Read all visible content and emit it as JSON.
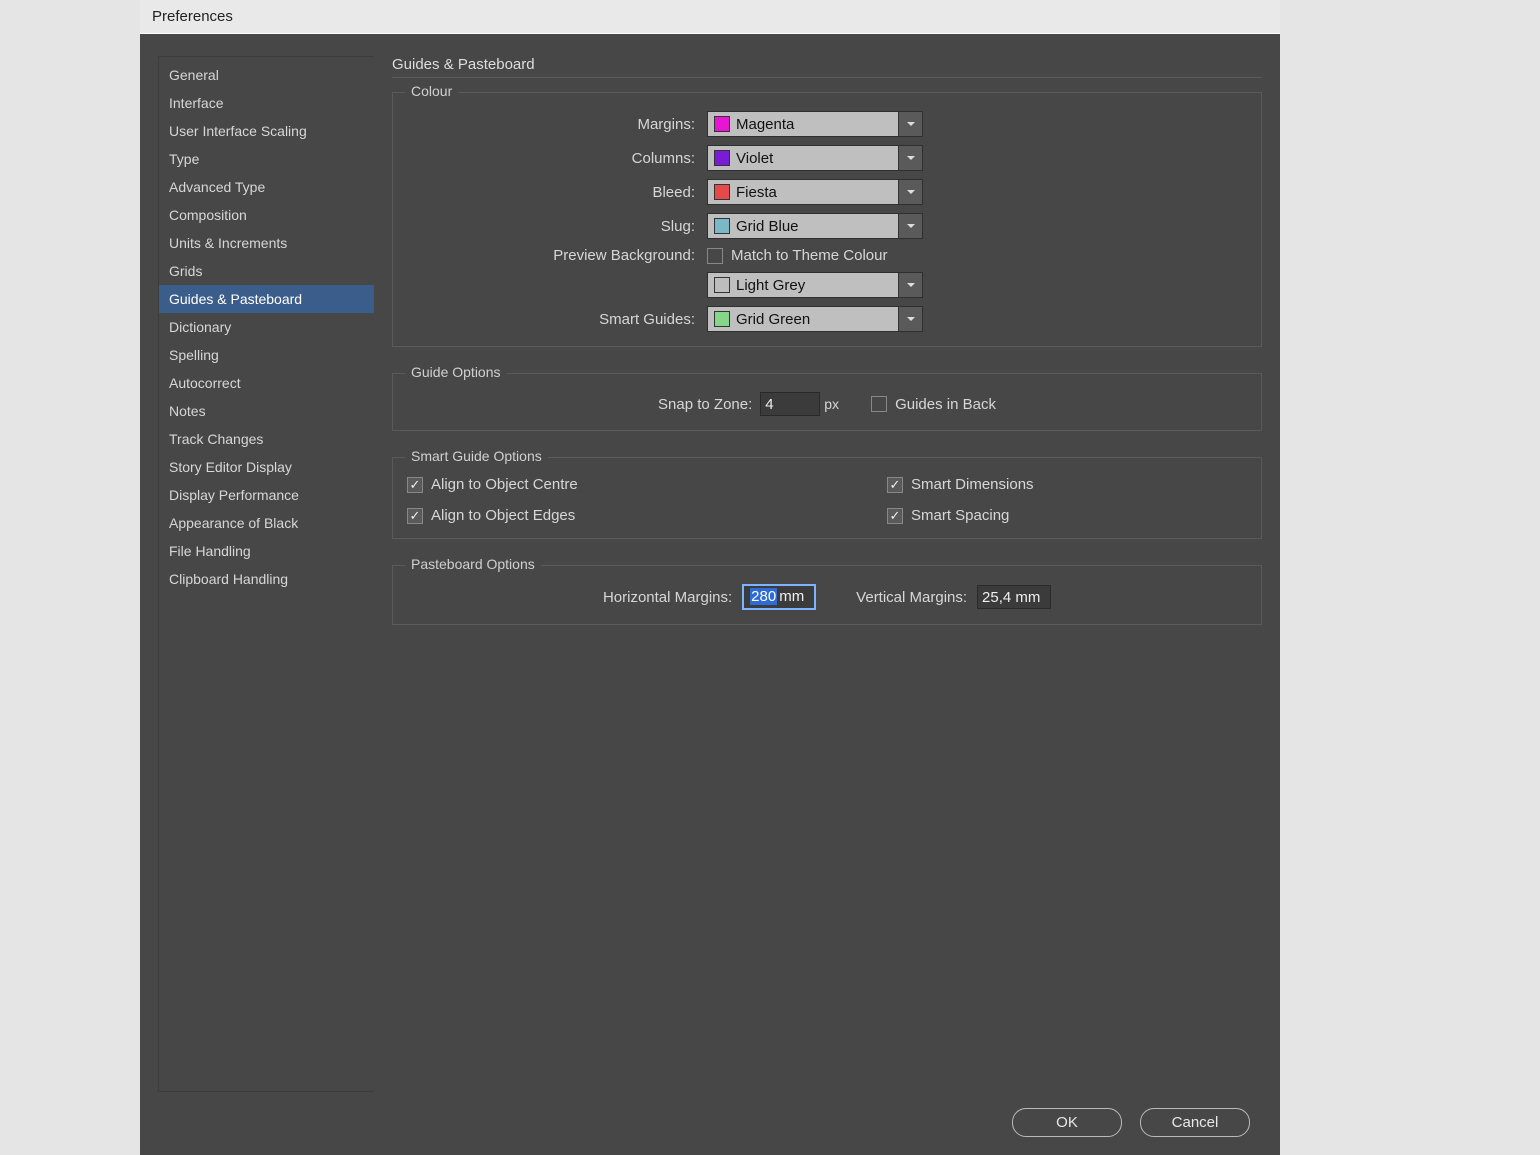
{
  "window": {
    "title": "Preferences"
  },
  "sidebar": {
    "items": [
      "General",
      "Interface",
      "User Interface Scaling",
      "Type",
      "Advanced Type",
      "Composition",
      "Units & Increments",
      "Grids",
      "Guides & Pasteboard",
      "Dictionary",
      "Spelling",
      "Autocorrect",
      "Notes",
      "Track Changes",
      "Story Editor Display",
      "Display Performance",
      "Appearance of Black",
      "File Handling",
      "Clipboard Handling"
    ],
    "selected_index": 8
  },
  "page": {
    "title": "Guides & Pasteboard",
    "colour": {
      "legend": "Colour",
      "rows": {
        "margins": {
          "label": "Margins:",
          "value": "Magenta",
          "swatch": "#e815d3"
        },
        "columns": {
          "label": "Columns:",
          "value": "Violet",
          "swatch": "#7a1cd6"
        },
        "bleed": {
          "label": "Bleed:",
          "value": "Fiesta",
          "swatch": "#e44a4a"
        },
        "slug": {
          "label": "Slug:",
          "value": "Grid Blue",
          "swatch": "#7ab7c7"
        },
        "preview_bg": {
          "label": "Preview Background:",
          "checkbox_label": "Match to Theme Colour",
          "checked": false,
          "value": "Light Grey",
          "swatch": "#bdbdbd"
        },
        "smart_guides": {
          "label": "Smart Guides:",
          "value": "Grid Green",
          "swatch": "#86d68a"
        }
      }
    },
    "guide_options": {
      "legend": "Guide Options",
      "snap_label": "Snap to Zone:",
      "snap_value": "4",
      "snap_unit": "px",
      "guides_in_back": {
        "label": "Guides in Back",
        "checked": false
      }
    },
    "smart_guide_options": {
      "legend": "Smart Guide Options",
      "align_centre": {
        "label": "Align to Object Centre",
        "checked": true
      },
      "align_edges": {
        "label": "Align to Object Edges",
        "checked": true
      },
      "smart_dimensions": {
        "label": "Smart Dimensions",
        "checked": true
      },
      "smart_spacing": {
        "label": "Smart Spacing",
        "checked": true
      }
    },
    "pasteboard_options": {
      "legend": "Pasteboard Options",
      "horiz_label": "Horizontal Margins:",
      "horiz_value": "280",
      "horiz_unit": "mm",
      "vert_label": "Vertical Margins:",
      "vert_value": "25,4 mm"
    }
  },
  "footer": {
    "ok": "OK",
    "cancel": "Cancel"
  }
}
